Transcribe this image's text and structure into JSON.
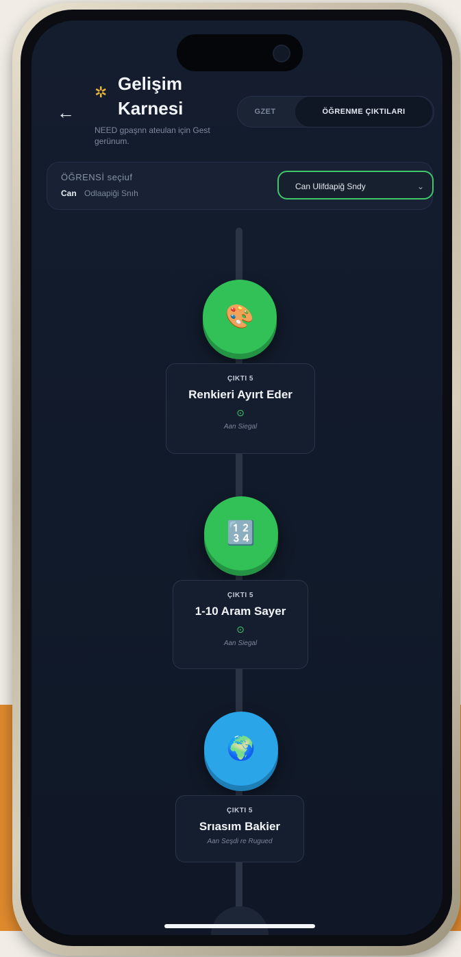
{
  "header": {
    "back_icon": "arrow-left-icon",
    "star_icon": "star-icon",
    "title_line1": "Gelişim",
    "title_line2": "Karnesi",
    "subtitle": "NEED gpaşnn ateulan için Gest gerünum."
  },
  "segment": {
    "options": [
      "GZET",
      "ÖĞRENME ÇIKTILARI"
    ],
    "selected": "ÖĞRENME ÇIKTILARI"
  },
  "student_selector": {
    "label": "ÖĞRENSİ seçiuf",
    "name": "Can",
    "detail": "Odlaapiği Snıh",
    "dropdown_value": "Can Ulifdapiğ Sndy",
    "dropdown_icon": "chevron-down-icon"
  },
  "timeline": {
    "items": [
      {
        "icon": "palette-icon",
        "tag": "ÇIKTI 5",
        "title": "Renkieri Ayırt Eder",
        "status_icon": "check-circle-icon",
        "footer": "Aan Siegal"
      },
      {
        "icon": "numbers-icon",
        "tag": "ÇIKTI 5",
        "title": "1-10 Aram Sayer",
        "status_icon": "check-circle-icon",
        "footer": "Aan Siegal"
      },
      {
        "icon": "globe-icon",
        "tag": "ÇIKTI 5",
        "title": "Srıasım Bakier",
        "footer": "Aan Seşdi re Rugued"
      }
    ]
  },
  "colors": {
    "background": "#141d2e",
    "accent_green": "#32c157",
    "accent_blue": "#2aa5e8",
    "star_gold": "#e7b43c",
    "page_orange": "#e08a2e"
  }
}
